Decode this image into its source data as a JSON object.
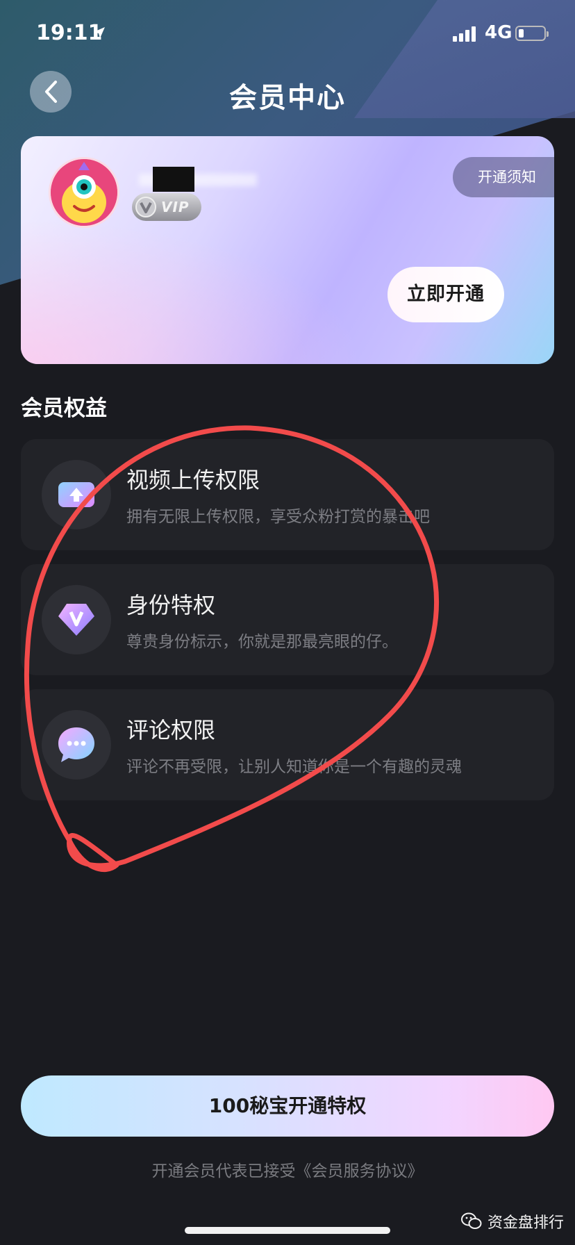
{
  "status_bar": {
    "time": "19:11",
    "network": "4G"
  },
  "header": {
    "title": "会员中心"
  },
  "member_card": {
    "username": "",
    "vip_label": "VIP",
    "notice_label": "开通须知",
    "open_now_label": "立即开通"
  },
  "benefits": {
    "title": "会员权益",
    "items": [
      {
        "title": "视频上传权限",
        "desc": "拥有无限上传权限，享受众粉打赏的暴击吧",
        "icon": "video-upload-icon"
      },
      {
        "title": "身份特权",
        "desc": "尊贵身份标示，你就是那最亮眼的仔。",
        "icon": "vip-diamond-icon"
      },
      {
        "title": "评论权限",
        "desc": "评论不再受限，让别人知道你是一个有趣的灵魂",
        "icon": "comment-bubble-icon"
      }
    ]
  },
  "footer": {
    "cta_label": "100秘宝开通特权",
    "agreement": "开通会员代表已接受《会员服务协议》",
    "watermark": "资金盘排行"
  },
  "colors": {
    "background": "#1a1b20",
    "benefit_card": "#222328",
    "annotation": "#f24b4b",
    "muted_text": "#7d7e84"
  }
}
